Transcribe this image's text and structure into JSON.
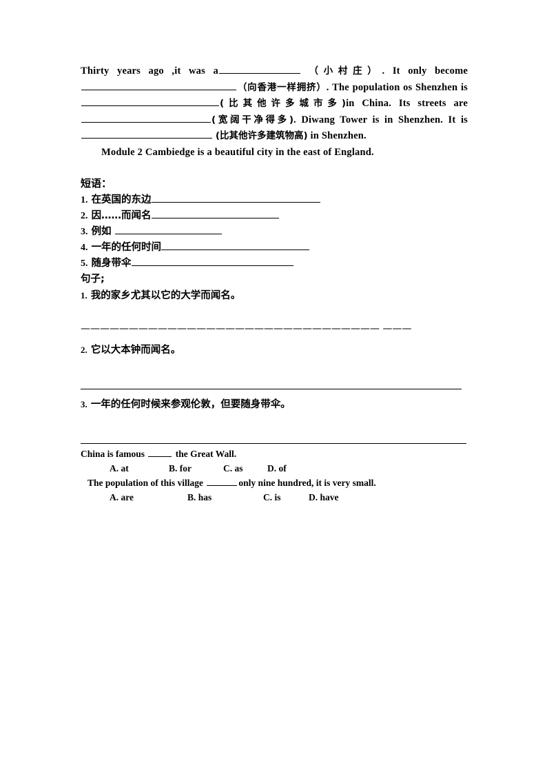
{
  "document": {
    "paragraph": {
      "s1_pre": "Thirty  years  ago  ,it  was  a",
      "s1_cn": "（小村庄）",
      "s1_post": ".  It  only  become",
      "s2_cn": "（向香港一样拥挤）",
      "s2_post": ". The population os Shenzhen",
      "s3_pre": "is",
      "s3_cn": "(比其他许多城市多)",
      "s3_post": "in  China.  Its  streets  are",
      "s4_cn": "(宽阔干净得多)",
      "s4_post": ".  Diwang  Tower  is  in  Shenzhen.  It",
      "s5_pre": "is",
      "s5_cn": "(比其他许多建筑物高)",
      "s5_post": " in Shenzhen."
    },
    "module_heading": "Module  2  Cambiedge  is  a  beautiful  city  in  the  east  of  England.",
    "phrases_label": "短语：",
    "phrases": [
      {
        "num": "1.",
        "text": "在英国的东边"
      },
      {
        "num": "2.",
        "text": "因……而闻名"
      },
      {
        "num": "3.",
        "text": "例如 "
      },
      {
        "num": "4.",
        "text": "一年的任何时间"
      },
      {
        "num": "5.",
        "text": "随身带伞"
      }
    ],
    "sentences_label": "句子;",
    "sentences": [
      {
        "num": "1.",
        "text": "我的家乡尤其以它的大学而闻名。"
      },
      {
        "num": "2.",
        "text": "它以大本钟而闻名。"
      },
      {
        "num": "3.",
        "text": "一年的任何时候来参观伦敦，但要随身带伞。"
      }
    ],
    "dash_rule": "——————————————————————————————— ———",
    "multiple_choice": [
      {
        "question_pre": "China is famous",
        "question_post": "the Great Wall.",
        "options": [
          "A. at",
          "B. for",
          "C. as",
          "D. of"
        ]
      },
      {
        "question_pre": "The population of this village",
        "question_post": "only nine hundred, it is very small.",
        "options": [
          "A. are",
          "B. has",
          "C. is",
          "D. have"
        ]
      }
    ]
  }
}
